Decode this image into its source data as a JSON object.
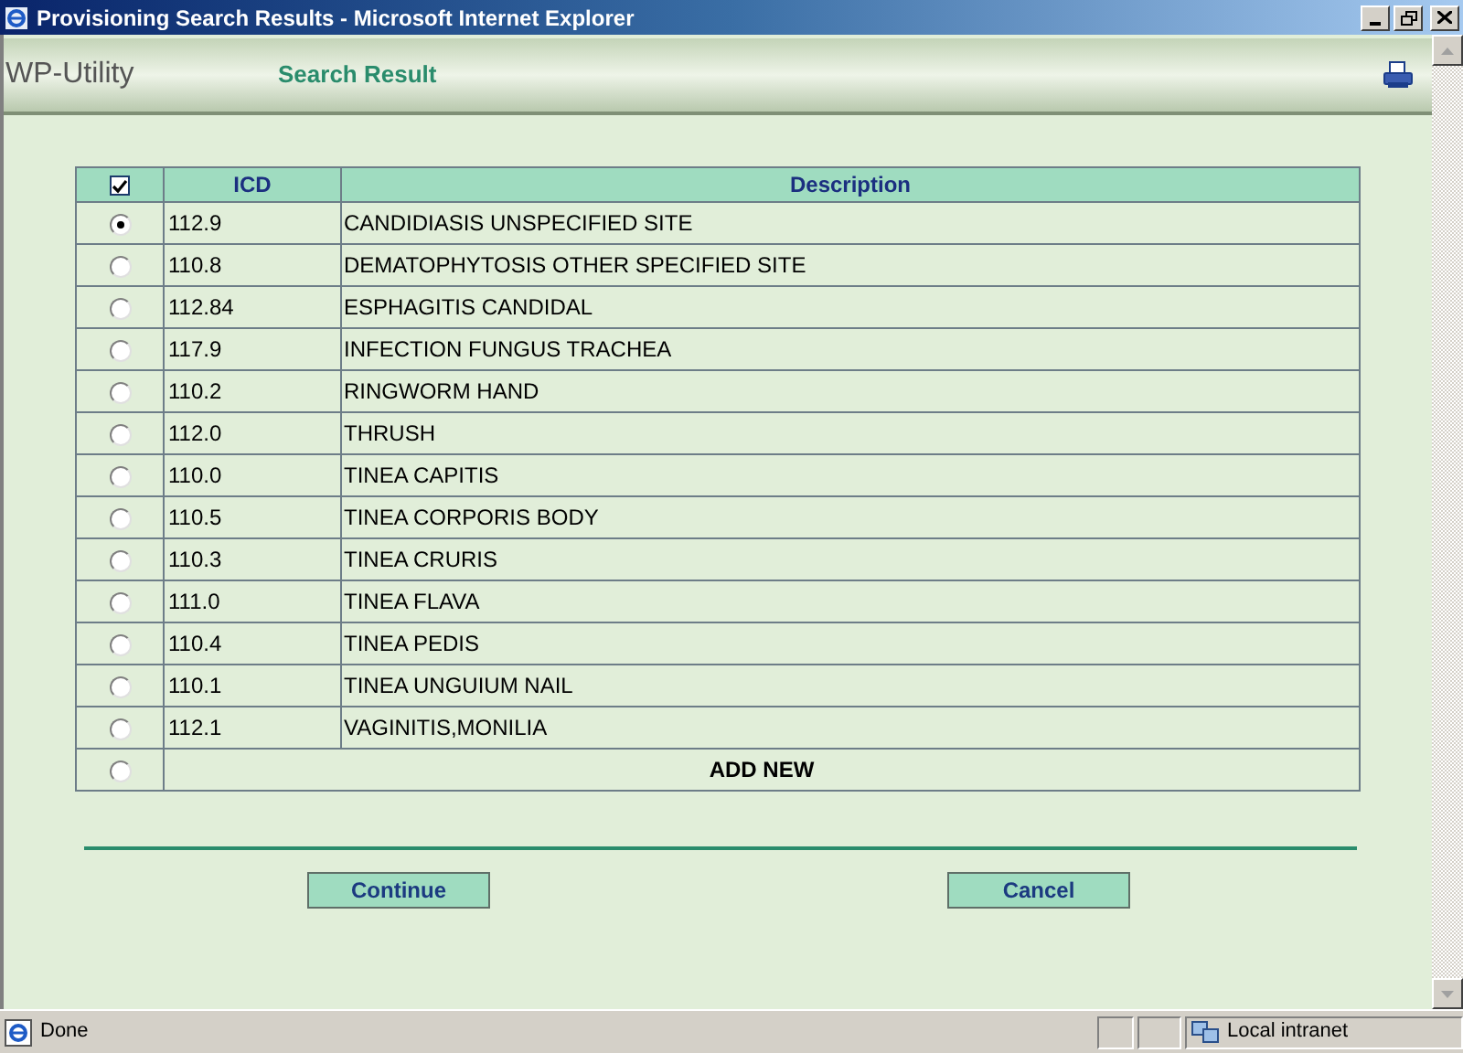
{
  "window": {
    "title": "Provisioning Search Results - Microsoft Internet Explorer"
  },
  "header": {
    "app_name": "WP-Utility",
    "page_title": "Search Result"
  },
  "table": {
    "select_all": {
      "checked": true
    },
    "columns": [
      "ICD",
      "Description"
    ],
    "rows": [
      {
        "icd": "112.9",
        "description": "CANDIDIASIS UNSPECIFIED SITE",
        "selected": true
      },
      {
        "icd": "110.8",
        "description": "DEMATOPHYTOSIS OTHER SPECIFIED SITE",
        "selected": false
      },
      {
        "icd": "112.84",
        "description": "ESPHAGITIS CANDIDAL",
        "selected": false
      },
      {
        "icd": "117.9",
        "description": "INFECTION FUNGUS TRACHEA",
        "selected": false
      },
      {
        "icd": "110.2",
        "description": "RINGWORM HAND",
        "selected": false
      },
      {
        "icd": "112.0",
        "description": "THRUSH",
        "selected": false
      },
      {
        "icd": "110.0",
        "description": "TINEA CAPITIS",
        "selected": false
      },
      {
        "icd": "110.5",
        "description": "TINEA CORPORIS BODY",
        "selected": false
      },
      {
        "icd": "110.3",
        "description": "TINEA CRURIS",
        "selected": false
      },
      {
        "icd": "111.0",
        "description": "TINEA FLAVA",
        "selected": false
      },
      {
        "icd": "110.4",
        "description": "TINEA PEDIS",
        "selected": false
      },
      {
        "icd": "110.1",
        "description": "TINEA UNGUIUM NAIL",
        "selected": false
      },
      {
        "icd": "112.1",
        "description": "VAGINITIS,MONILIA",
        "selected": false
      }
    ],
    "add_new": {
      "label": "ADD NEW",
      "selected": false
    }
  },
  "buttons": [
    "Continue",
    "Cancel"
  ],
  "status_bar": {
    "text": "Done",
    "zone": "Local intranet"
  }
}
